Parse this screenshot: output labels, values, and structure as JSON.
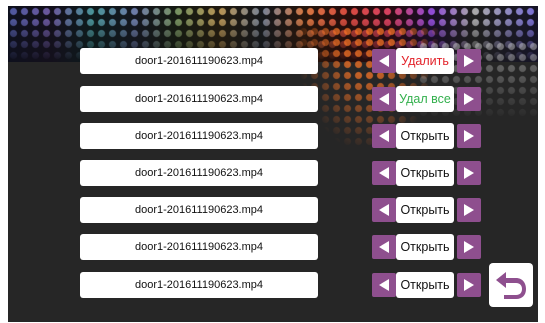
{
  "files": [
    {
      "name": "door1-201611190623.mp4",
      "action": "Удалить",
      "action_color": "#e3222a"
    },
    {
      "name": "door1-201611190623.mp4",
      "action": "Удал все",
      "action_color": "#33b04d"
    },
    {
      "name": "door1-201611190623.mp4",
      "action": "Открыть",
      "action_color": "#111111"
    },
    {
      "name": "door1-201611190623.mp4",
      "action": "Открыть",
      "action_color": "#111111"
    },
    {
      "name": "door1-201611190623.mp4",
      "action": "Открыть",
      "action_color": "#111111"
    },
    {
      "name": "door1-201611190623.mp4",
      "action": "Открыть",
      "action_color": "#111111"
    },
    {
      "name": "door1-201611190623.mp4",
      "action": "Открыть",
      "action_color": "#111111"
    }
  ],
  "icons": {
    "prev": "triangle-left-icon",
    "next": "triangle-right-icon",
    "back": "return-arrow-icon"
  },
  "colors": {
    "background": "#262626",
    "arrow_button": "#8e4f8e",
    "back_icon": "#8e4f8e"
  }
}
